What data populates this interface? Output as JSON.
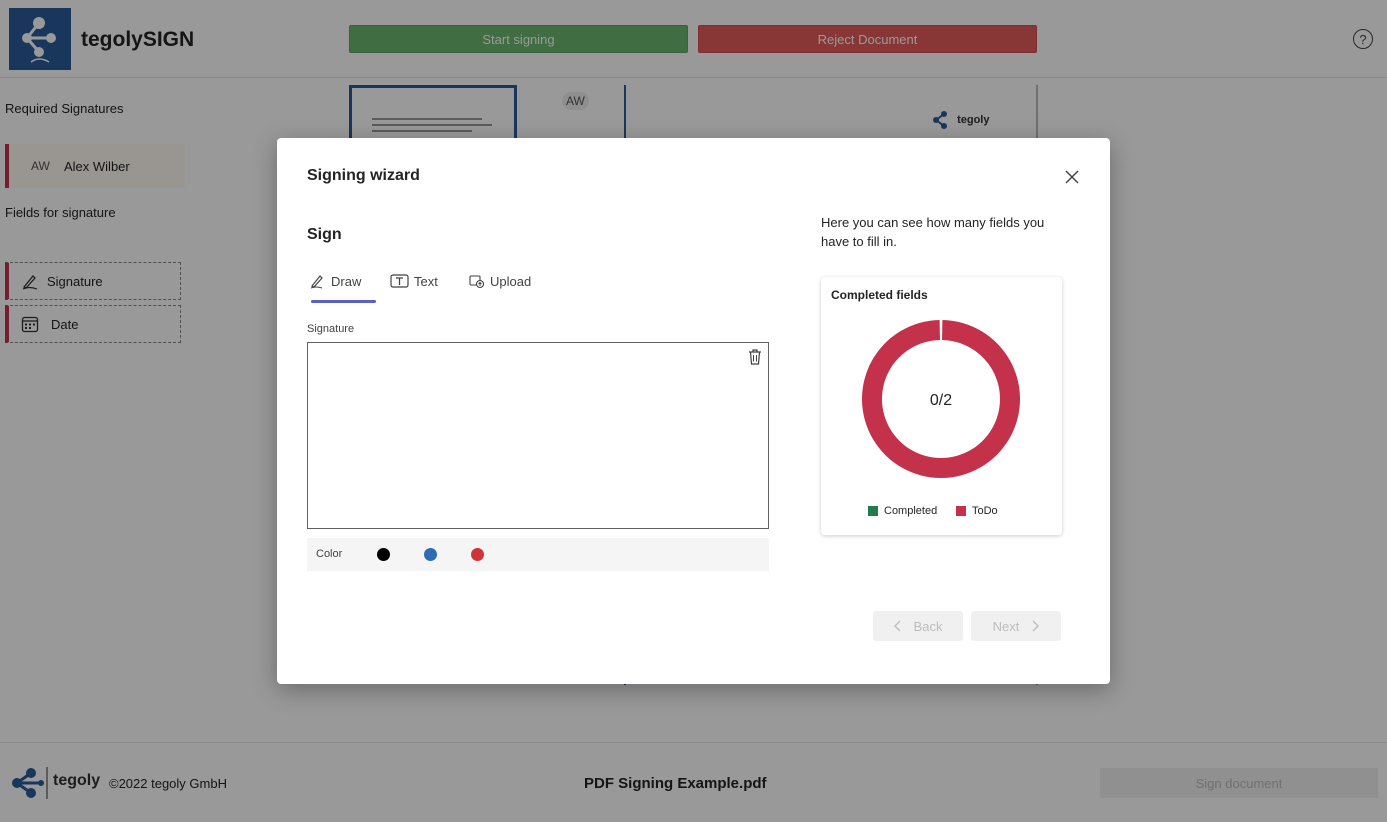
{
  "app": {
    "title": "tegolySIGN",
    "start_signing": "Start signing",
    "reject_document": "Reject Document",
    "help": "?"
  },
  "sidebar": {
    "required_signatures": "Required Signatures",
    "signer_initials": "AW",
    "signer_name": "Alex Wilber",
    "fields_for_signature": "Fields for signature",
    "fields": [
      {
        "label": "Signature",
        "icon": "signature-pen-icon"
      },
      {
        "label": "Date",
        "icon": "calendar-icon"
      }
    ]
  },
  "document": {
    "tag_initials": "AW",
    "logo_text": "tegoly"
  },
  "footer": {
    "brand": "tegoly",
    "copyright": "©2022 tegoly GmbH",
    "filename": "PDF Signing Example.pdf",
    "sign_document": "Sign document"
  },
  "modal": {
    "title": "Signing wizard",
    "step_title": "Sign",
    "tabs": [
      {
        "label": "Draw",
        "icon": "pen-icon",
        "active": true
      },
      {
        "label": "Text",
        "icon": "text-box-icon",
        "active": false
      },
      {
        "label": "Upload",
        "icon": "upload-image-icon",
        "active": false
      }
    ],
    "signature_label": "Signature",
    "color_label": "Color",
    "colors": [
      "#000000",
      "#2f6cb5",
      "#d13438"
    ],
    "info_text": "Here you can see how many fields you have to fill in.",
    "back_label": "Back",
    "next_label": "Next"
  },
  "chart_data": {
    "type": "pie",
    "title": "Completed fields",
    "center_label": "0/2",
    "categories": [
      "Completed",
      "ToDo"
    ],
    "values": [
      0,
      2
    ],
    "colors": [
      "#237b4b",
      "#c4314b"
    ],
    "legend_position": "bottom"
  }
}
